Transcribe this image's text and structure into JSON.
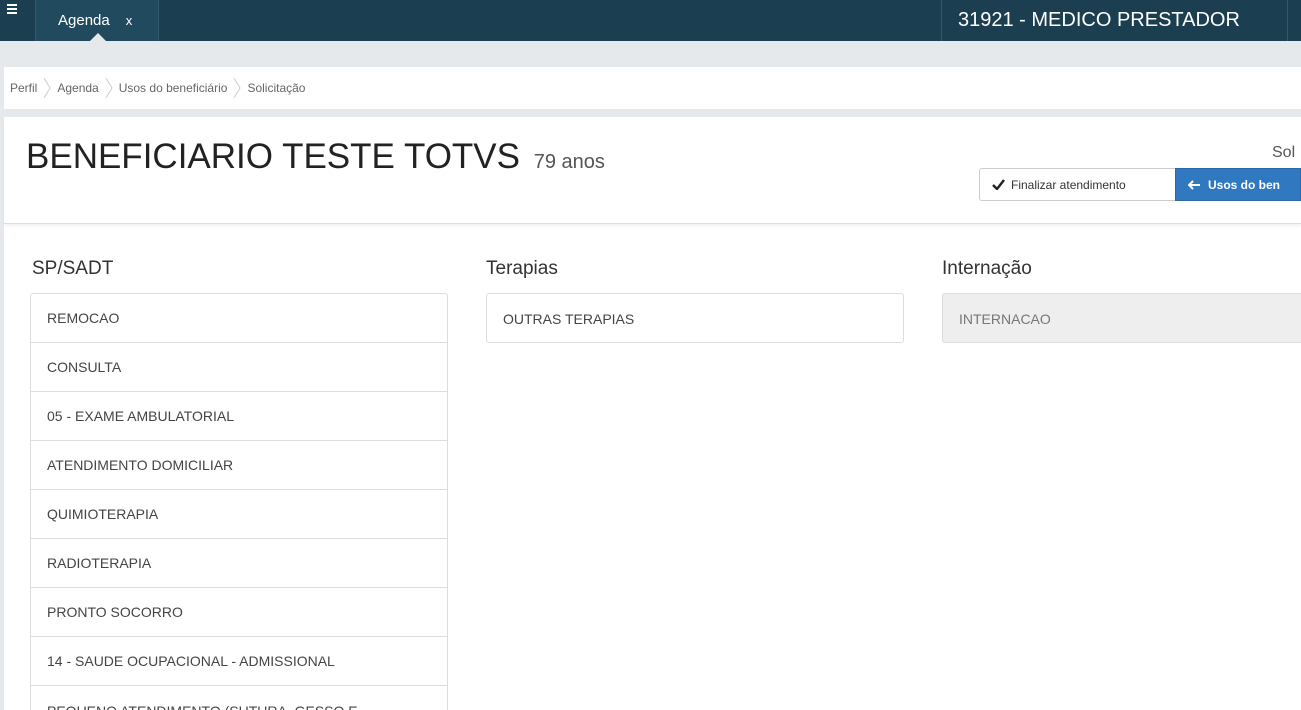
{
  "topbar": {
    "menu_icon": "hamburger-menu-icon",
    "tab_label": "Agenda",
    "tab_close": "x",
    "user_label": "31921 - MEDICO PRESTADOR"
  },
  "breadcrumb": [
    "Perfil",
    "Agenda",
    "Usos do beneficiário",
    "Solicitação"
  ],
  "header": {
    "name": "BENEFICIARIO TESTE TOTVS",
    "age": "79 anos",
    "right_label": "Sol",
    "finalizar_label": "Finalizar atendimento",
    "usos_label": "Usos do ben"
  },
  "columns": {
    "sadt": {
      "title": "SP/SADT",
      "items": [
        "REMOCAO",
        "CONSULTA",
        "05 - EXAME AMBULATORIAL",
        "ATENDIMENTO DOMICILIAR",
        "QUIMIOTERAPIA",
        "RADIOTERAPIA",
        "PRONTO SOCORRO",
        "14 - SAUDE OCUPACIONAL - ADMISSIONAL",
        "PEQUENO ATENDIMENTO (SUTURA, GESSO E"
      ]
    },
    "terapias": {
      "title": "Terapias",
      "items": [
        "OUTRAS TERAPIAS"
      ]
    },
    "internacao": {
      "title": "Internação",
      "items": [
        "INTERNACAO"
      ]
    }
  },
  "colors": {
    "topbar": "#1b3f50",
    "primary_button": "#3078bf",
    "page_bg": "#e6e9ec"
  }
}
